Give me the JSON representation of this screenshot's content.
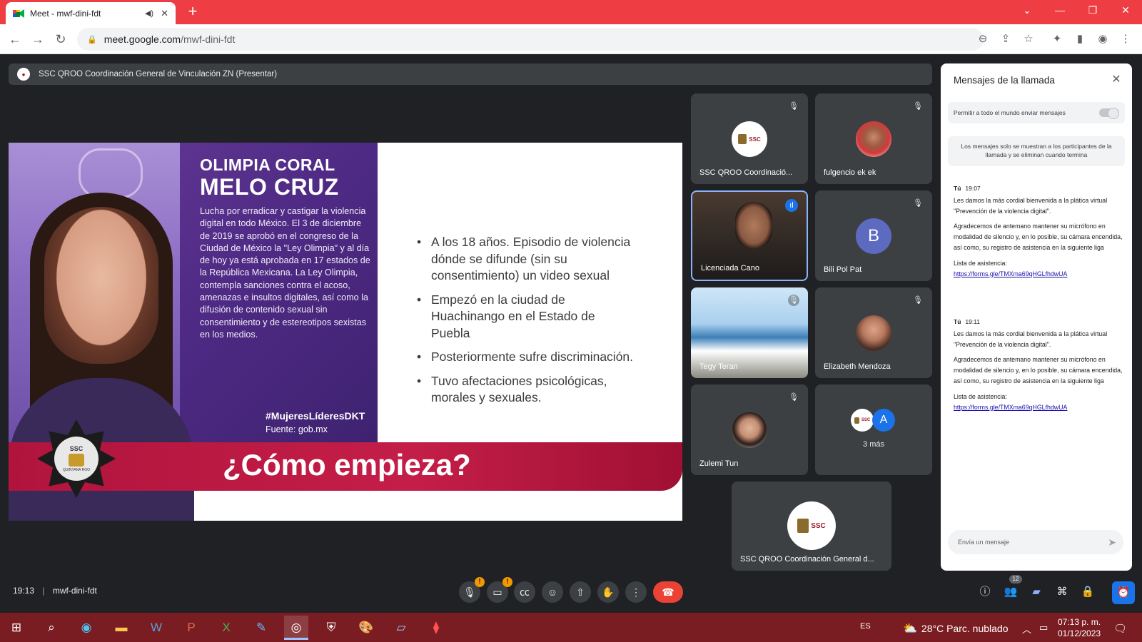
{
  "browser": {
    "tab_title": "Meet - mwf-dini-fdt",
    "new_tab": "+",
    "url_domain": "meet.google.com",
    "url_path": "/mwf-dini-fdt"
  },
  "presenter_bar": {
    "text": "SSC QROO Coordinación General de Vinculación ZN (Presentar)"
  },
  "slide": {
    "name_line1": "OLIMPIA CORAL",
    "name_line2": "MELO CRUZ",
    "bio": "Lucha por erradicar y castigar la violencia digital en todo México. El 3 de diciembre de 2019 se aprobó en el congreso de la Ciudad de México la \"Ley Olimpia\" y al día de hoy ya está aprobada en 17 estados de la República Mexicana. La Ley Olimpia, contempla sanciones contra el acoso, amenazas e insultos digitales, así como la difusión de contenido sexual sin consentimiento y de estereotipos sexistas en los medios.",
    "hashtag": "#MujeresLíderesDKT",
    "source": "Fuente: gob.mx",
    "bullets": [
      "A los 18 años. Episodio de violencia dónde se difunde (sin su consentimiento) un video sexual",
      "Empezó en la ciudad de Huachinango en el Estado de Puebla",
      "Posteriormente sufre discriminación.",
      "Tuvo afectaciones psicológicas, morales y sexuales."
    ],
    "banner": "¿Cómo empieza?",
    "badge_text": "SSC",
    "badge_sub": "QUINTANA ROO"
  },
  "participants": [
    {
      "name": "SSC QROO Coordinació...",
      "muted": true
    },
    {
      "name": "fulgencio ek ek",
      "muted": true
    },
    {
      "name": "Licenciada Cano",
      "speaking": true
    },
    {
      "name": "Bili Pol Pat",
      "initial": "B",
      "muted": true
    },
    {
      "name": "Tegy Teran",
      "muted": true
    },
    {
      "name": "Elizabeth Mendoza",
      "muted": true
    },
    {
      "name": "Zulemi Tun",
      "muted": true
    },
    {
      "name": "3 más",
      "initial": "A"
    },
    {
      "name": "SSC QROO Coordinación General d..."
    }
  ],
  "chat": {
    "title": "Mensajes de la llamada",
    "permission_label": "Permitir a todo el mundo enviar mensajes",
    "notice": "Los mensajes solo se muestran a los participantes de la llamada y se eliminan cuando termina",
    "messages": [
      {
        "sender": "Tú",
        "time": "19:07",
        "p1": "Les damos la más cordial bienvenida a la plática virtual \"Prevención de la violencia digital\".",
        "p2": "Agradecemos de antemano mantener su micrófono en modalidad de silencio y, en lo posible, su cámara encendida, así como, su registro de asistencia en la siguiente liga",
        "p3": "Lista de asistencia:",
        "link": "https://forms.gle/TMXma69qHGLfhdwUA"
      },
      {
        "sender": "Tú",
        "time": "19:11",
        "p1": "Les damos la más cordial bienvenida a la plática virtual \"Prevención de la violencia digital\".",
        "p2": "Agradecemos de antemano mantener su micrófono en modalidad de silencio y, en lo posible, su cámara encendida, así como, su registro de asistencia en la siguiente liga",
        "p3": "Lista de asistencia:",
        "link": "https://forms.gle/TMXma69qHGLfhdwUA"
      }
    ],
    "input_placeholder": "Envía un mensaje"
  },
  "meeting": {
    "time": "19:13",
    "code": "mwf-dini-fdt",
    "participant_count": "12"
  },
  "taskbar": {
    "lang": "ES",
    "weather": "28°C  Parc. nublado",
    "time": "07:13 p. m.",
    "date": "01/12/2023"
  },
  "colors": {
    "browser_frame": "#ef3e43",
    "meet_bg": "#202124",
    "hangup": "#ea4335",
    "active_blue": "#1a73e8",
    "banner": "#c41e48"
  },
  "icons": [
    "back-icon",
    "forward-icon",
    "reload-icon",
    "lock-icon",
    "zoom-icon",
    "share-icon",
    "star-icon",
    "extensions-icon",
    "sidepanel-icon",
    "profile-icon",
    "menu-icon",
    "mic-off-icon",
    "camera-off-icon",
    "captions-icon",
    "emoji-icon",
    "present-icon",
    "hand-icon",
    "more-icon",
    "hangup-icon",
    "info-icon",
    "people-icon",
    "chat-icon",
    "activities-icon",
    "host-controls-icon",
    "activity-icon"
  ]
}
